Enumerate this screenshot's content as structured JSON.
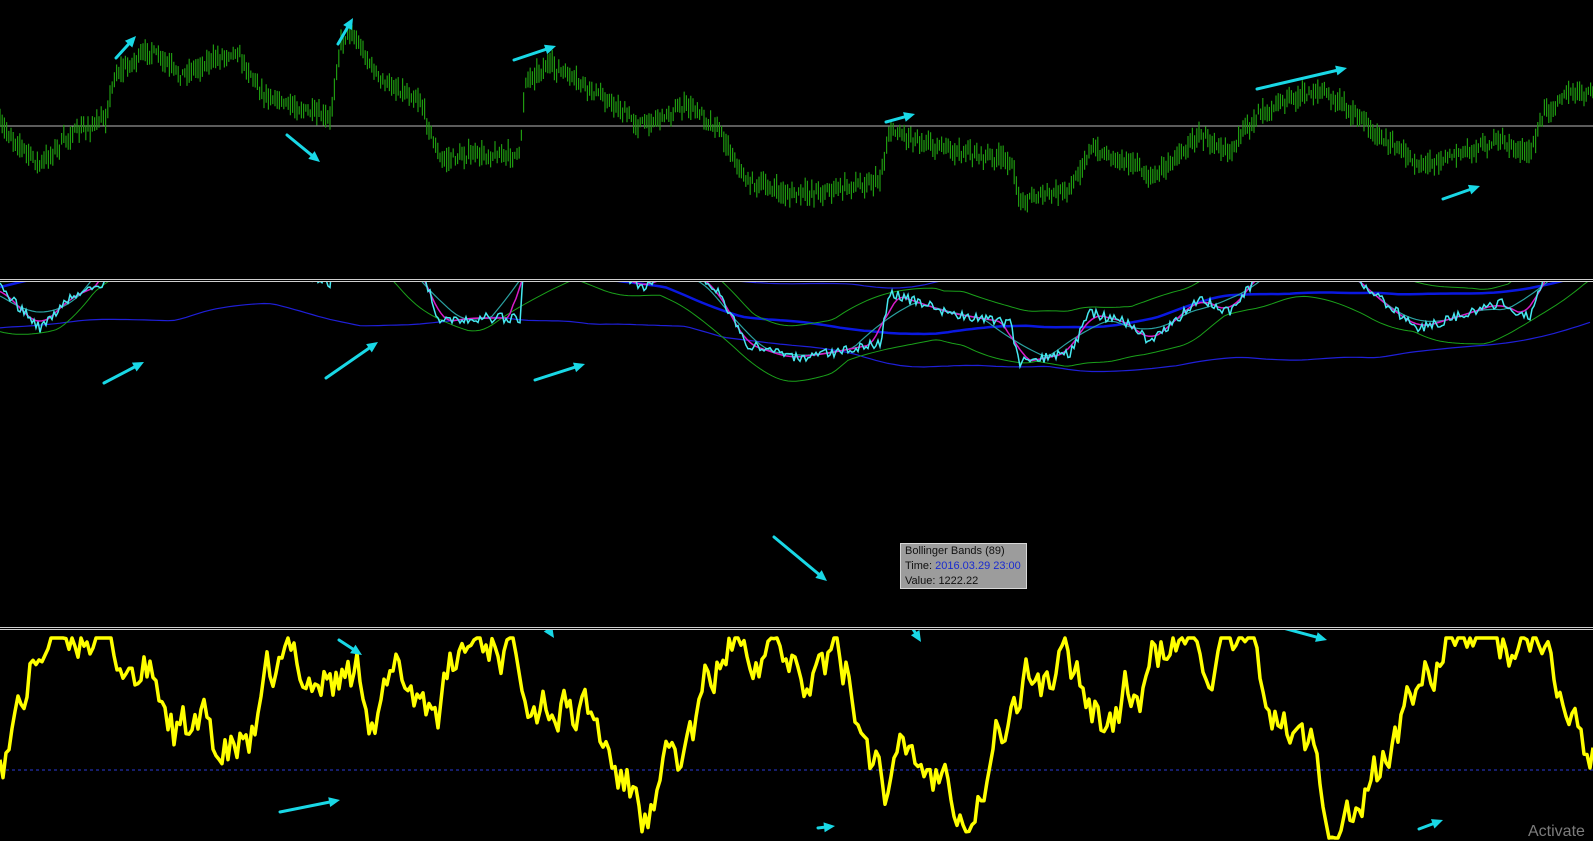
{
  "colors": {
    "background": "#000000",
    "price_bars": "#1f9a10",
    "level_line": "#b8b8b8",
    "annotation_arrows": "#19d8e6",
    "bands_outer": "#1f1fd8",
    "bands_mid": "#0a18e0",
    "bands_green": "#1aa01a",
    "price_line": "#46e8f0",
    "magenta_ma": "#d81cc8",
    "oscillator": "#ffff00",
    "osc_level": "#2a3ad8"
  },
  "tooltip": {
    "title": "Bollinger Bands (89)",
    "time_label": "Time:",
    "time_value": "2016.03.29 23:00",
    "value_label": "Value:",
    "value": "1222.22"
  },
  "watermark": "Activate",
  "icons": [
    "trend-arrow-icon"
  ]
}
